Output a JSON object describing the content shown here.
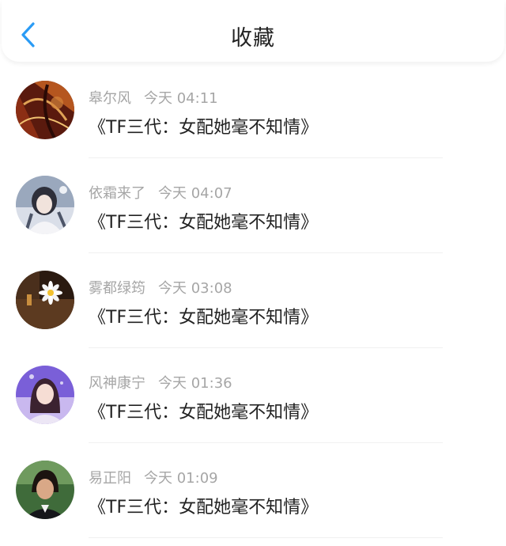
{
  "header": {
    "title": "收藏",
    "back_icon": "chevron-left-icon",
    "accent_color": "#2a9bf5"
  },
  "items": [
    {
      "username": "皋尔风",
      "time": "今天 04:11",
      "content": "《TF三代：女配她毫不知情》",
      "avatar": "dark-red-artwork"
    },
    {
      "username": "依霜来了",
      "time": "今天 04:07",
      "content": "《TF三代：女配她毫不知情》",
      "avatar": "anime-girl"
    },
    {
      "username": "雾都绿筠",
      "time": "今天 03:08",
      "content": "《TF三代：女配她毫不知情》",
      "avatar": "daisy-flower"
    },
    {
      "username": "风神康宁",
      "time": "今天 01:36",
      "content": "《TF三代：女配她毫不知情》",
      "avatar": "girl-portrait-purple"
    },
    {
      "username": "易正阳",
      "time": "今天 01:09",
      "content": "《TF三代：女配她毫不知情》",
      "avatar": "man-portrait"
    }
  ]
}
